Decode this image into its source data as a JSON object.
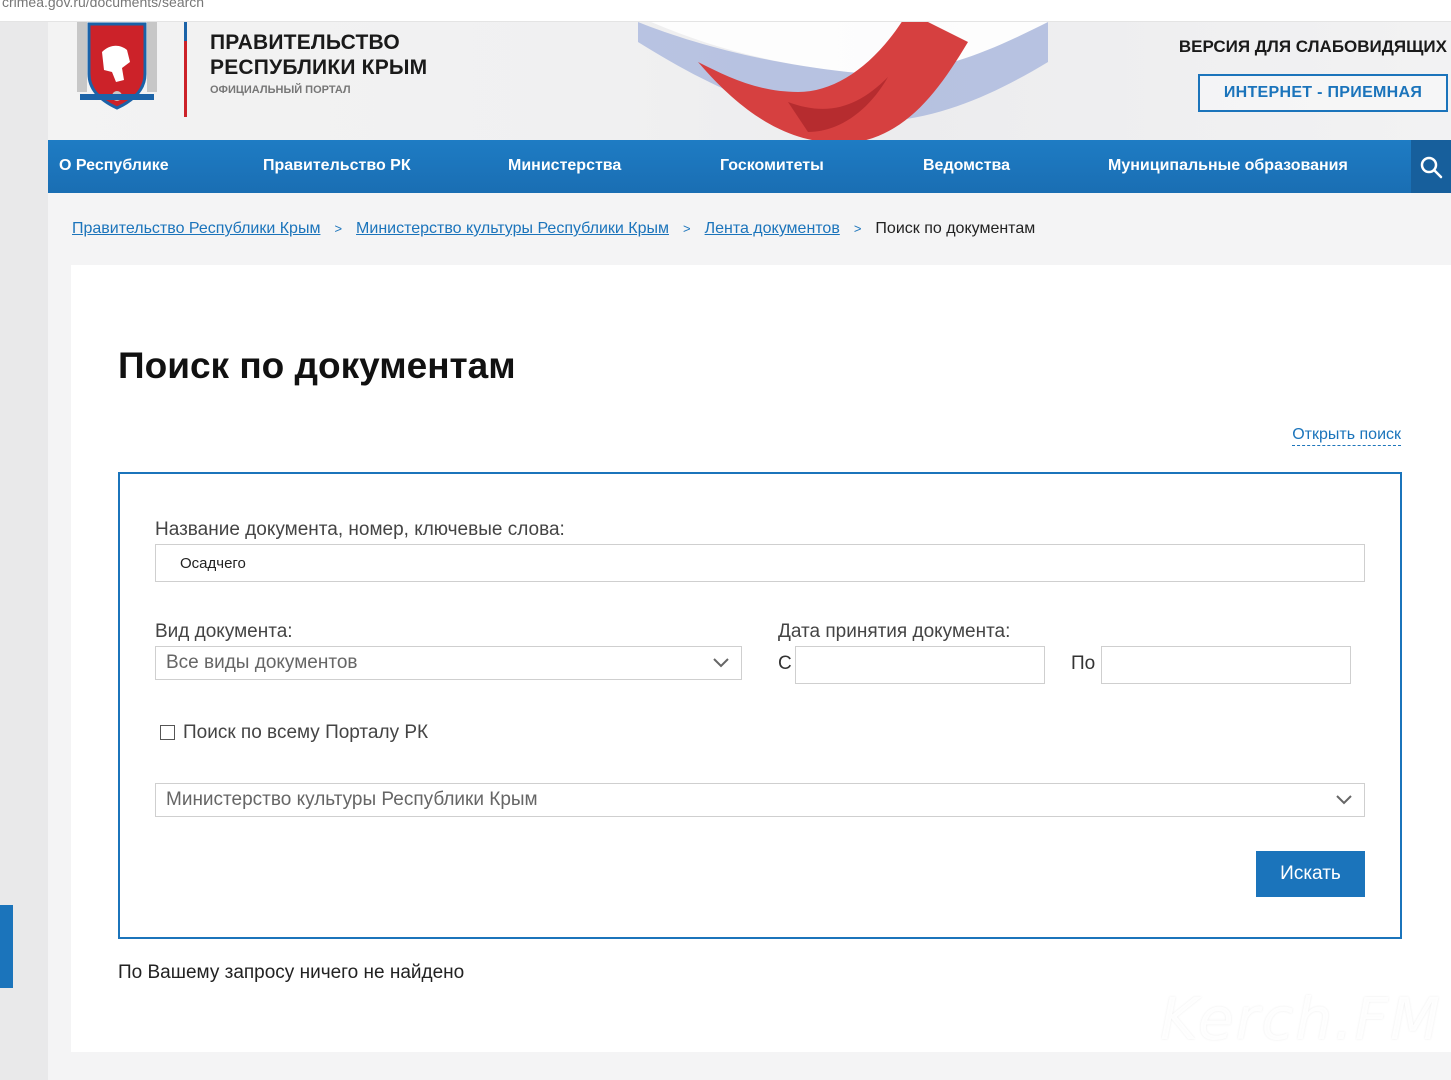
{
  "browser": {
    "url": "crimea.gov.ru/documents/search"
  },
  "header": {
    "title": "ПРАВИТЕЛЬСТВО\nРЕСПУБЛИКИ КРЫМ",
    "subtitle": "ОФИЦИАЛЬНЫЙ ПОРТАЛ",
    "vision_link": "ВЕРСИЯ ДЛЯ СЛАБОВИДЯЩИХ",
    "reception_button": "ИНТЕРНЕТ - ПРИЕМНАЯ",
    "emblem_icon": "crimea-coat-of-arms-icon",
    "colors": {
      "accent": "#1b74bb",
      "emblem_red": "#cc2229"
    }
  },
  "nav": {
    "items": [
      {
        "label": "О Республике"
      },
      {
        "label": "Правительство РК"
      },
      {
        "label": "Министерства"
      },
      {
        "label": "Госкомитеты"
      },
      {
        "label": "Ведомства"
      },
      {
        "label": "Муниципальные образования"
      }
    ],
    "search_icon": "search-icon"
  },
  "breadcrumb": {
    "items": [
      "Правительство Республики Крым",
      "Министерство культуры Республики Крым",
      "Лента документов"
    ],
    "separator": ">",
    "current": "Поиск по документам"
  },
  "main": {
    "title": "Поиск по документам",
    "open_search_link": "Открыть поиск",
    "form": {
      "name_label": "Название документа, номер, ключевые слова:",
      "name_value": "Осадчего",
      "type_label": "Вид документа:",
      "type_value": "Все виды документов",
      "date_label": "Дата принятия документа:",
      "date_from_label": "С",
      "date_to_label": "По",
      "date_from_value": "",
      "date_to_value": "",
      "portal_checkbox_label": "Поиск по всему Порталу РК",
      "portal_checkbox_checked": false,
      "organization_value": "Министерство культуры Республики Крым",
      "submit_label": "Искать"
    },
    "no_results": "По Вашему запросу ничего не найдено"
  },
  "watermark": "Kerch.FM"
}
